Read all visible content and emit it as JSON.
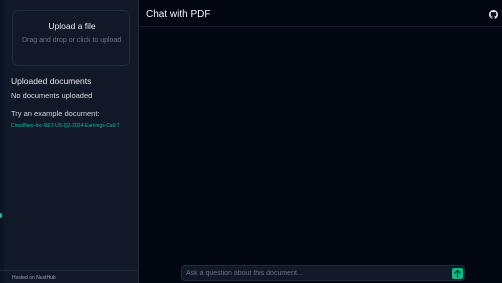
{
  "sidebar": {
    "upload": {
      "title": "Upload a file",
      "hint": "Drag and drop or click to upload"
    },
    "uploaded_heading": "Uploaded documents",
    "no_documents": "No documents uploaded",
    "try_label": "Try an example document:",
    "example_link": "Cloudflare-Inc-NET-US-Q2-2024-Earnings-Call-T",
    "footer": "Hosted on NuxtHub"
  },
  "header": {
    "title": "Chat with PDF",
    "github_icon": "github-icon"
  },
  "chat": {
    "placeholder": "Ask a question about this document...",
    "value": "",
    "send_icon": "arrow-up-icon"
  },
  "colors": {
    "accent": "#10b981",
    "link": "#14b8a6",
    "background": "#030712",
    "sidebar": "#111827"
  }
}
